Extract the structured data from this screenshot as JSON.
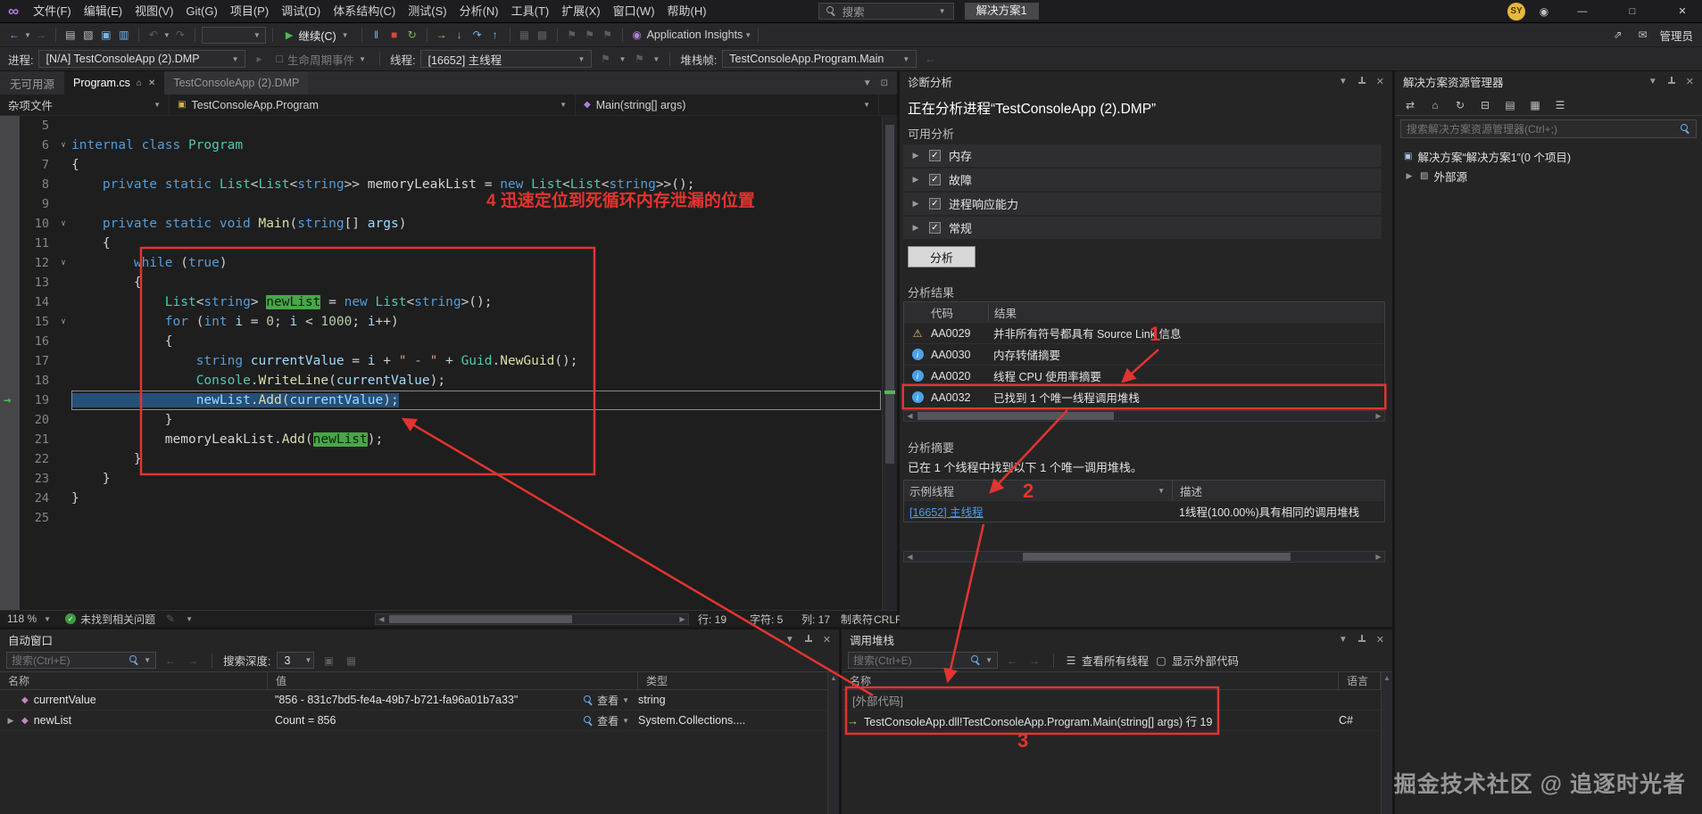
{
  "colors": {
    "annotation_red": "#e23430",
    "link_blue": "#4e9ae8",
    "reference_highlight_green": "#4aa54a",
    "editor_bg": "#1e1e1e",
    "panel_bg": "#252526",
    "selection": "#264f78"
  },
  "title_bar": {
    "menus": [
      "文件(F)",
      "编辑(E)",
      "视图(V)",
      "Git(G)",
      "项目(P)",
      "调试(D)",
      "体系结构(C)",
      "测试(S)",
      "分析(N)",
      "工具(T)",
      "扩展(X)",
      "窗口(W)",
      "帮助(H)"
    ],
    "search_label": "搜索",
    "solution_badge": "解决方案1",
    "avatar": "SY",
    "admin_label": "管理员"
  },
  "toolbar": {
    "continue_label": "继续(C)",
    "app_insights_label": "Application Insights"
  },
  "debug_bar": {
    "process_label": "进程:",
    "process_value": "[N/A] TestConsoleApp (2).DMP",
    "lifecycle_label": "生命周期事件",
    "thread_label": "线程:",
    "thread_value": "[16652] 主线程",
    "frame_label": "堆栈帧:",
    "frame_value": "TestConsoleApp.Program.Main"
  },
  "editor": {
    "no_source_tab": "无可用源",
    "tabs": [
      {
        "label": "Program.cs",
        "active": true
      },
      {
        "label": "TestConsoleApp (2).DMP",
        "active": false
      }
    ],
    "nav": [
      "杂项文件",
      "TestConsoleApp.Program",
      "Main(string[] args)"
    ],
    "status": {
      "zoom": "118 %",
      "health": "未找到相关问题",
      "line": "行: 19",
      "char": "字符: 5",
      "col": "列: 17",
      "tabs_label": "制表符",
      "eol": "CRLF"
    },
    "code_lines": [
      {
        "n": 5,
        "seg": []
      },
      {
        "n": 6,
        "fold": true,
        "seg": [
          [
            "kw",
            "internal class "
          ],
          [
            "ty",
            "Program"
          ]
        ]
      },
      {
        "n": 7,
        "seg": [
          [
            "pu",
            "{"
          ]
        ]
      },
      {
        "n": 8,
        "seg": [
          [
            "pu",
            "    "
          ],
          [
            "kw",
            "private static "
          ],
          [
            "ty",
            "List"
          ],
          [
            "pu",
            "<"
          ],
          [
            "ty",
            "List"
          ],
          [
            "pu",
            "<"
          ],
          [
            "kw",
            "string"
          ],
          [
            "pu",
            ">> "
          ],
          [
            "fi",
            "memoryLeakList"
          ],
          [
            "pu",
            " = "
          ],
          [
            "kw",
            "new "
          ],
          [
            "ty",
            "List"
          ],
          [
            "pu",
            "<"
          ],
          [
            "ty",
            "List"
          ],
          [
            "pu",
            "<"
          ],
          [
            "kw",
            "string"
          ],
          [
            "pu",
            ">>();"
          ]
        ]
      },
      {
        "n": 9,
        "seg": []
      },
      {
        "n": 10,
        "fold": true,
        "seg": [
          [
            "pu",
            "    "
          ],
          [
            "kw",
            "private static void "
          ],
          [
            "me",
            "Main"
          ],
          [
            "pu",
            "("
          ],
          [
            "kw",
            "string"
          ],
          [
            "pu",
            "[] "
          ],
          [
            "va",
            "args"
          ],
          [
            "pu",
            ")"
          ]
        ]
      },
      {
        "n": 11,
        "seg": [
          [
            "pu",
            "    {"
          ]
        ]
      },
      {
        "n": 12,
        "fold": true,
        "seg": [
          [
            "pu",
            "        "
          ],
          [
            "kw",
            "while "
          ],
          [
            "pu",
            "("
          ],
          [
            "kw",
            "true"
          ],
          [
            "pu",
            ")"
          ]
        ]
      },
      {
        "n": 13,
        "seg": [
          [
            "pu",
            "        {"
          ]
        ]
      },
      {
        "n": 14,
        "seg": [
          [
            "pu",
            "            "
          ],
          [
            "ty",
            "List"
          ],
          [
            "pu",
            "<"
          ],
          [
            "kw",
            "string"
          ],
          [
            "pu",
            "> "
          ],
          [
            "vh",
            "newList"
          ],
          [
            "pu",
            " = "
          ],
          [
            "kw",
            "new "
          ],
          [
            "ty",
            "List"
          ],
          [
            "pu",
            "<"
          ],
          [
            "kw",
            "string"
          ],
          [
            "pu",
            ">();"
          ]
        ]
      },
      {
        "n": 15,
        "fold": true,
        "seg": [
          [
            "pu",
            "            "
          ],
          [
            "kw",
            "for "
          ],
          [
            "pu",
            "("
          ],
          [
            "kw",
            "int "
          ],
          [
            "va",
            "i"
          ],
          [
            "pu",
            " = "
          ],
          [
            "nu",
            "0"
          ],
          [
            "pu",
            "; "
          ],
          [
            "va",
            "i"
          ],
          [
            "pu",
            " < "
          ],
          [
            "nu",
            "1000"
          ],
          [
            "pu",
            "; "
          ],
          [
            "va",
            "i"
          ],
          [
            "pu",
            "++)"
          ]
        ]
      },
      {
        "n": 16,
        "seg": [
          [
            "pu",
            "            {"
          ]
        ]
      },
      {
        "n": 17,
        "seg": [
          [
            "pu",
            "                "
          ],
          [
            "kw",
            "string "
          ],
          [
            "va",
            "currentValue"
          ],
          [
            "pu",
            " = "
          ],
          [
            "va",
            "i"
          ],
          [
            "pu",
            " + "
          ],
          [
            "st",
            "\" - \""
          ],
          [
            "pu",
            " + "
          ],
          [
            "ty",
            "Guid"
          ],
          [
            "pu",
            "."
          ],
          [
            "me",
            "NewGuid"
          ],
          [
            "pu",
            "();"
          ]
        ]
      },
      {
        "n": 18,
        "seg": [
          [
            "pu",
            "                "
          ],
          [
            "ty",
            "Console"
          ],
          [
            "pu",
            "."
          ],
          [
            "me",
            "WriteLine"
          ],
          [
            "pu",
            "("
          ],
          [
            "va",
            "currentValue"
          ],
          [
            "pu",
            ");"
          ]
        ]
      },
      {
        "n": 19,
        "cur": true,
        "sel": true,
        "seg": [
          [
            "pu",
            "                "
          ],
          [
            "va",
            "newList"
          ],
          [
            "pu",
            "."
          ],
          [
            "me",
            "Add"
          ],
          [
            "pu",
            "("
          ],
          [
            "va",
            "currentValue"
          ],
          [
            "pu",
            ");"
          ]
        ]
      },
      {
        "n": 20,
        "seg": [
          [
            "pu",
            "            }"
          ]
        ]
      },
      {
        "n": 21,
        "seg": [
          [
            "pu",
            "            "
          ],
          [
            "fi",
            "memoryLeakList"
          ],
          [
            "pu",
            "."
          ],
          [
            "me",
            "Add"
          ],
          [
            "pu",
            "("
          ],
          [
            "vh",
            "newList"
          ],
          [
            "pu",
            ");"
          ]
        ]
      },
      {
        "n": 22,
        "seg": [
          [
            "pu",
            "        }"
          ]
        ]
      },
      {
        "n": 23,
        "seg": [
          [
            "pu",
            "    }"
          ]
        ]
      },
      {
        "n": 24,
        "seg": [
          [
            "pu",
            "}"
          ]
        ]
      },
      {
        "n": 25,
        "seg": []
      }
    ]
  },
  "diagnostics": {
    "title": "诊断分析",
    "heading": "正在分析进程“TestConsoleApp (2).DMP”",
    "available_label": "可用分析",
    "available": [
      "内存",
      "故障",
      "进程响应能力",
      "常规"
    ],
    "analyze_button": "分析",
    "results_label": "分析结果",
    "results_headers": [
      "代码",
      "结果"
    ],
    "results": [
      {
        "icon": "warning",
        "code": "AA0029",
        "text": "并非所有符号都具有 Source Link 信息",
        "highlighted": false
      },
      {
        "icon": "info",
        "code": "AA0030",
        "text": "内存转储摘要",
        "highlighted": false
      },
      {
        "icon": "info",
        "code": "AA0020",
        "text": "线程 CPU 使用率摘要",
        "highlighted": false
      },
      {
        "icon": "info",
        "code": "AA0032",
        "text": "已找到 1 个唯一线程调用堆栈",
        "highlighted": true
      }
    ],
    "summary_label": "分析摘要",
    "summary_text": "已在 1 个线程中找到以下 1 个唯一调用堆栈。",
    "threads_headers": [
      "示例线程",
      "描述"
    ],
    "thread_link": "[16652] 主线程",
    "thread_desc": "1线程(100.00%)具有相同的调用堆栈"
  },
  "solution_explorer": {
    "title": "解决方案资源管理器",
    "search_placeholder": "搜索解决方案资源管理器(Ctrl+;)",
    "items": [
      "解决方案“解决方案1”(0 个项目)",
      "外部源"
    ]
  },
  "autos": {
    "title": "自动窗口",
    "search_placeholder": "搜索(Ctrl+E)",
    "depth_label": "搜索深度:",
    "depth_value": "3",
    "headers": [
      "名称",
      "值",
      "类型"
    ],
    "rows": [
      {
        "name": "currentValue",
        "value": "\"856 - 831c7bd5-fe4a-49b7-b721-fa96a01b7a33\"",
        "view": "查看",
        "type": "string",
        "expandable": false
      },
      {
        "name": "newList",
        "value": "Count = 856",
        "view": "查看",
        "type": "System.Collections....",
        "expandable": true
      }
    ]
  },
  "call_stack": {
    "title": "调用堆栈",
    "search_placeholder": "搜索(Ctrl+E)",
    "buttons": [
      "查看所有线程",
      "显示外部代码"
    ],
    "headers": [
      "名称",
      "语言"
    ],
    "rows": [
      {
        "name": "[外部代码]",
        "lang": "",
        "current": false,
        "dim": true
      },
      {
        "name": "TestConsoleApp.dll!TestConsoleApp.Program.Main(string[] args) 行 19",
        "lang": "C#",
        "current": true,
        "dim": false
      }
    ]
  },
  "annotations": {
    "label1": "1",
    "label2": "2",
    "label3": "3",
    "label4": "4 迅速定位到死循环内存泄漏的位置"
  },
  "watermark": "掘金技术社区 @ 追逐时光者"
}
